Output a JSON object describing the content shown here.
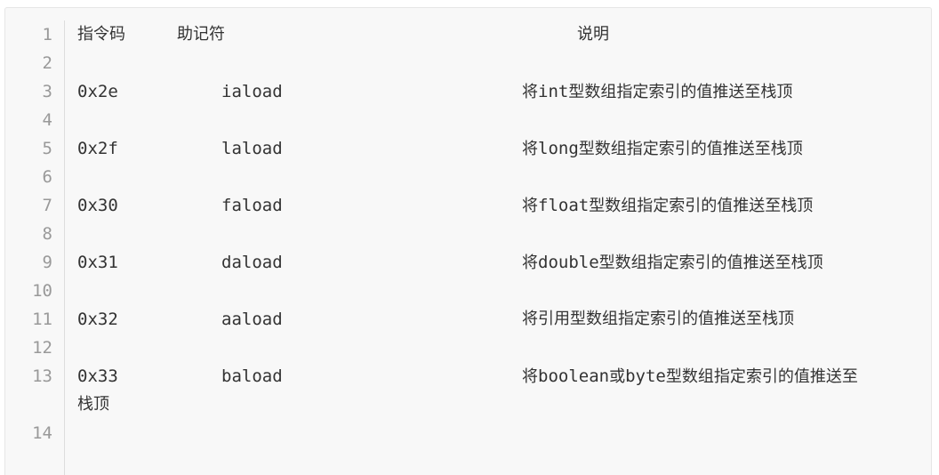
{
  "header": {
    "opcode": "指令码",
    "mnemonic": "助记符",
    "description": "说明"
  },
  "line_numbers": [
    "1",
    "2",
    "3",
    "4",
    "5",
    "6",
    "7",
    "8",
    "9",
    "10",
    "11",
    "12",
    "13",
    "14"
  ],
  "rows": [
    {
      "opcode": "0x2e",
      "mnemonic": "iaload",
      "pre": "将",
      "type": "int",
      "post": "型数组指定索引的值推送至栈顶"
    },
    {
      "opcode": "0x2f",
      "mnemonic": "laload",
      "pre": "将",
      "type": "long",
      "post": "型数组指定索引的值推送至栈顶"
    },
    {
      "opcode": "0x30",
      "mnemonic": "faload",
      "pre": "将",
      "type": "float",
      "post": "型数组指定索引的值推送至栈顶"
    },
    {
      "opcode": "0x31",
      "mnemonic": "daload",
      "pre": "将",
      "type": "double",
      "post": "型数组指定索引的值推送至栈顶"
    },
    {
      "opcode": "0x32",
      "mnemonic": "aaload",
      "pre": "将引用型数组指定索引的值推送至栈顶",
      "type": "",
      "post": ""
    },
    {
      "opcode": "0x33",
      "mnemonic": "baload",
      "pre": "将",
      "type": "boolean",
      "mid": "或",
      "type2": "byte",
      "post": "型数组指定索引的值推送至",
      "wrap": "栈顶"
    }
  ]
}
